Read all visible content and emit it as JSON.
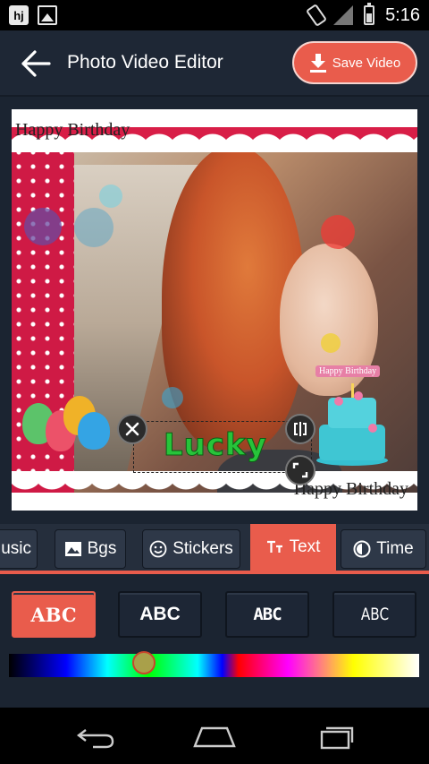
{
  "status_bar": {
    "time": "5:16",
    "notif_letter": "hj"
  },
  "toolbar": {
    "title": "Photo Video Editor",
    "save_label": "Save Video"
  },
  "canvas": {
    "frame_text_top": "Happy Birthday",
    "frame_text_bottom": "Happy Birthday",
    "cake_label": "Happy Birthday",
    "sticker_text": "Lucky"
  },
  "tabs": [
    {
      "label": "Music",
      "visible_label": "lusic",
      "icon": "music-icon"
    },
    {
      "label": "Bgs",
      "icon": "image-icon"
    },
    {
      "label": "Stickers",
      "icon": "smiley-icon"
    },
    {
      "label": "Text",
      "icon": "text-icon",
      "active": true
    },
    {
      "label": "Time",
      "icon": "timer-icon"
    }
  ],
  "text_styles": [
    "ABC",
    "ABC",
    "ABC",
    "ABC"
  ],
  "selected_text_style_index": 0,
  "text_color_position": 0.33,
  "colors": {
    "accent": "#e95c4c",
    "background": "#1b2431",
    "sticker_text": "#27c43a"
  }
}
